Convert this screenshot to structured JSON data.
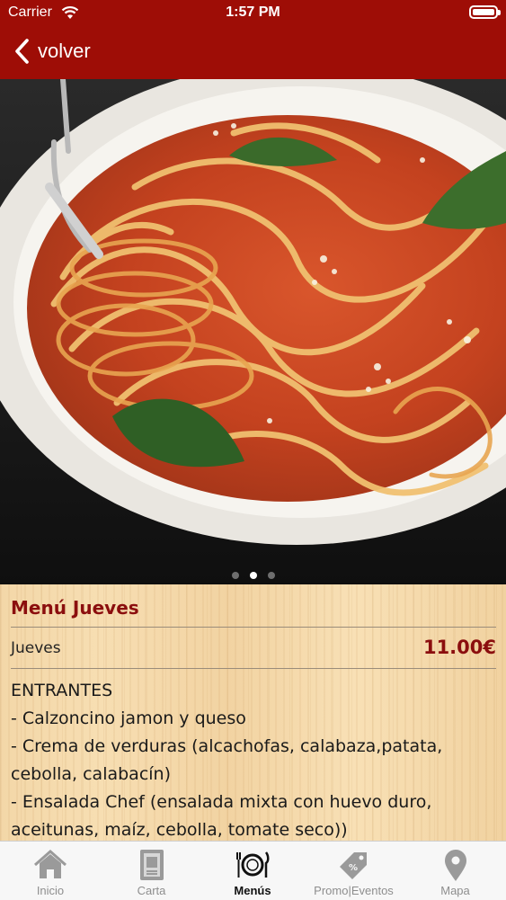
{
  "status_bar": {
    "carrier": "Carrier",
    "time": "1:57 PM"
  },
  "nav": {
    "back_label": "volver"
  },
  "gallery": {
    "page_count": 3,
    "active_index": 1
  },
  "menu": {
    "title": "Menú Jueves",
    "day": "Jueves",
    "price": "11.00€",
    "lines": [
      "ENTRANTES",
      "- Calzoncino jamon y queso",
      "- Crema de verduras (alcachofas, calabaza,patata,",
      "cebolla, calabacín)",
      "- Ensalada Chef (ensalada mixta con huevo duro,",
      "aceitunas, maíz, cebolla, tomate seco))"
    ]
  },
  "tabbar": {
    "items": [
      {
        "label": "Inicio",
        "icon": "house-icon"
      },
      {
        "label": "Carta",
        "icon": "menu-card-icon"
      },
      {
        "label": "Menús",
        "icon": "plate-cutlery-icon"
      },
      {
        "label": "Promo|Eventos",
        "icon": "price-tag-icon"
      },
      {
        "label": "Mapa",
        "icon": "map-pin-icon"
      }
    ],
    "active_index": 2
  },
  "colors": {
    "header": "#9e0d06",
    "accent": "#8b0e0e"
  }
}
